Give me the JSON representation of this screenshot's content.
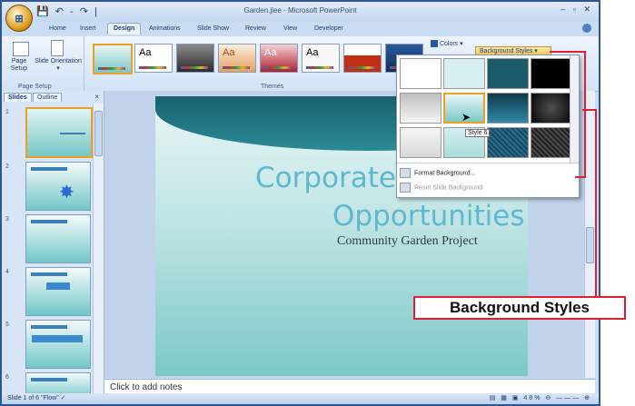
{
  "window": {
    "title": "Garden.jlee - Microsoft PowerPoint",
    "controls": "– ▫ ✕",
    "quick_access": "💾 ↶ - ↷ |",
    "office_button_glyph": "⊞"
  },
  "ribbon": {
    "tabs": [
      "Home",
      "Insert",
      "Design",
      "Animations",
      "Slide Show",
      "Review",
      "View",
      "Developer"
    ],
    "active_tab": "Design",
    "page_setup": {
      "page_setup_label": "Page Setup",
      "slide_orientation_label": "Slide Orientation ▾",
      "group_label": "Page Setup"
    },
    "themes": {
      "group_label": "Themes",
      "theme_text": "Aa"
    },
    "colors_label": "Colors ▾",
    "background_styles_label": "Background Styles ▾"
  },
  "pane": {
    "tabs": [
      "Slides",
      "Outline"
    ],
    "close": "×",
    "slide_numbers": [
      "1",
      "2",
      "3",
      "4",
      "5",
      "6"
    ]
  },
  "slide": {
    "title_line1": "Corporate Vo",
    "title_line2": "Opportunities",
    "subtitle": "Community Garden Project"
  },
  "notes": {
    "placeholder": "Click to add notes"
  },
  "status_bar": {
    "left": "Slide 1 of 6   \"Flow\"   ✓",
    "right": "▤ ▦ ▣  48%  ⊖ ——— ⊕"
  },
  "gallery": {
    "tooltip": "Style 6",
    "menu_items": [
      "Format Background...",
      "Reset Slide Background"
    ]
  },
  "callout": {
    "label": "Background Styles",
    "color": "#e02030"
  },
  "colors": {
    "accent": "#f0a020",
    "slide_title": "#5fb8d1",
    "ribbon_bg": "#d3e3f6"
  }
}
